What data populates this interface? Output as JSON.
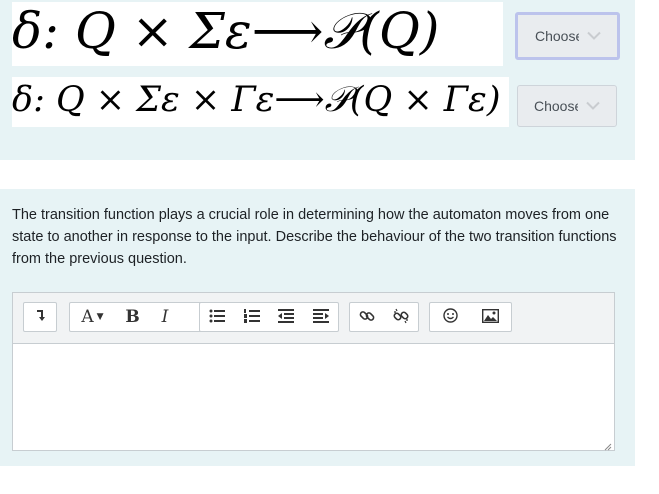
{
  "question1": {
    "formula_1": "δ: Q × Σε⟶𝒫(Q)",
    "formula_2": "δ: Q × Σε × Γε⟶𝒫(Q × Γε)",
    "select_1_value": "Choose...",
    "select_2_value": "Choose..."
  },
  "question2": {
    "text": "The transition function plays a crucial role in determining how the automaton moves from one state to another in response to the input.  Describe the behaviour of the two transition functions from the previous question.",
    "editor": {
      "toolbar": {
        "paragraph_icon": "show-more-icon",
        "font_style_label": "A",
        "bold_label": "B",
        "italic_label": "I",
        "unordered_list_icon": "unordered-list-icon",
        "ordered_list_icon": "ordered-list-icon",
        "outdent_icon": "outdent-icon",
        "indent_icon": "indent-icon",
        "link_icon": "link-icon",
        "unlink_icon": "unlink-icon",
        "emoji_icon": "emoji-icon",
        "image_icon": "image-icon"
      },
      "content": ""
    }
  },
  "colors": {
    "panel_bg": "#e7f3f5",
    "select_bg": "#e9ecef",
    "focus_border": "#bcc3ec"
  }
}
